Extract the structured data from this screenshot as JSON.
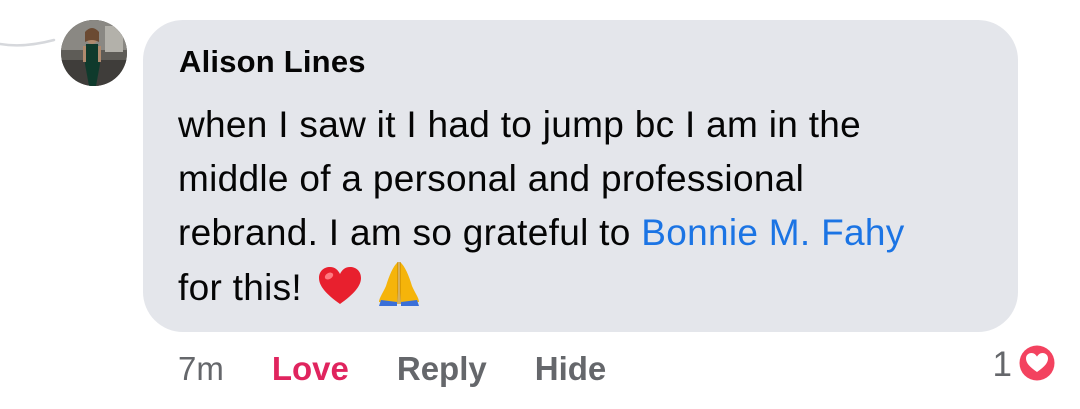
{
  "comment": {
    "author": "Alison Lines",
    "text_line1": "when I saw it I had to jump bc I am in the",
    "text_line2": "middle of a personal and professional",
    "text_line3_prefix": "rebrand. I am so grateful to ",
    "mention": "Bonnie M. Fahy",
    "text_line4": "for this!",
    "emojis": [
      "red-heart",
      "folded-hands"
    ]
  },
  "actions": {
    "time": "7m",
    "love_label": "Love",
    "reply_label": "Reply",
    "hide_label": "Hide"
  },
  "reactions": {
    "count": "1",
    "type": "love-reaction-icon"
  },
  "colors": {
    "bubble": "#e4e6eb",
    "mention": "#1b74e4",
    "love": "#e0245e",
    "secondary": "#65676b"
  }
}
